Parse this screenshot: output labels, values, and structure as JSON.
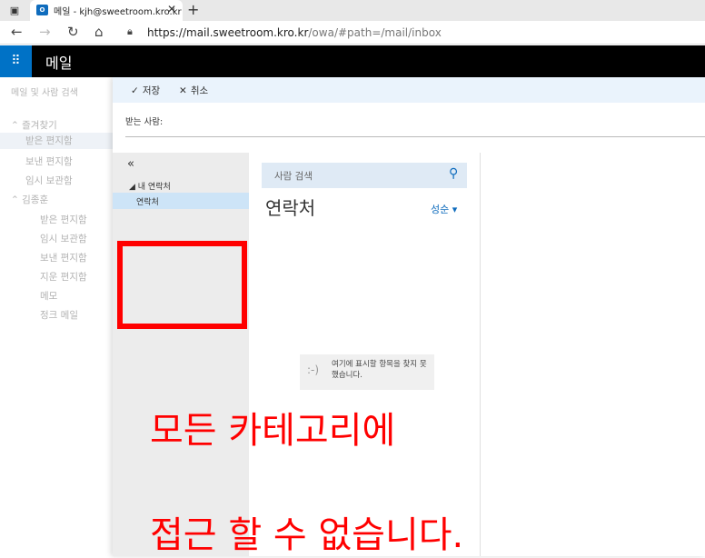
{
  "browser": {
    "tab_title": "메일 - kjh@sweetroom.kro.kr",
    "tab_icon": "O",
    "url_host": "https://mail.sweetroom.kro.kr",
    "url_path": "/owa/#path=/mail/inbox"
  },
  "owa": {
    "app_name": "메일",
    "search_placeholder": "메일 및 사람 검색"
  },
  "leftnav": {
    "favorites_header": "즐겨찾기",
    "favorites": [
      "받은 편지함",
      "보낸 편지함",
      "임시 보관함"
    ],
    "account_header": "김종훈",
    "folders": [
      "받은 편지함",
      "임시 보관함",
      "보낸 편지함",
      "지운 편지함",
      "메모",
      "정크 메일"
    ]
  },
  "compose": {
    "save_label": "저장",
    "cancel_label": "취소",
    "to_label": "받는 사람:"
  },
  "picker": {
    "collapse_icon": "«",
    "my_contacts_label": "◢ 내 연락처",
    "contacts_folder": "연락처",
    "search_placeholder": "사람 검색",
    "title": "연락처",
    "sort_label": "성순 ▾",
    "empty_face": ":-)",
    "empty_message": "여기에 표시할 항목을 찾지 못했습니다."
  },
  "annotation": {
    "line1": "모든 카테고리에",
    "line2": "접근 할 수 없습니다.",
    "color": "#ff0000"
  }
}
